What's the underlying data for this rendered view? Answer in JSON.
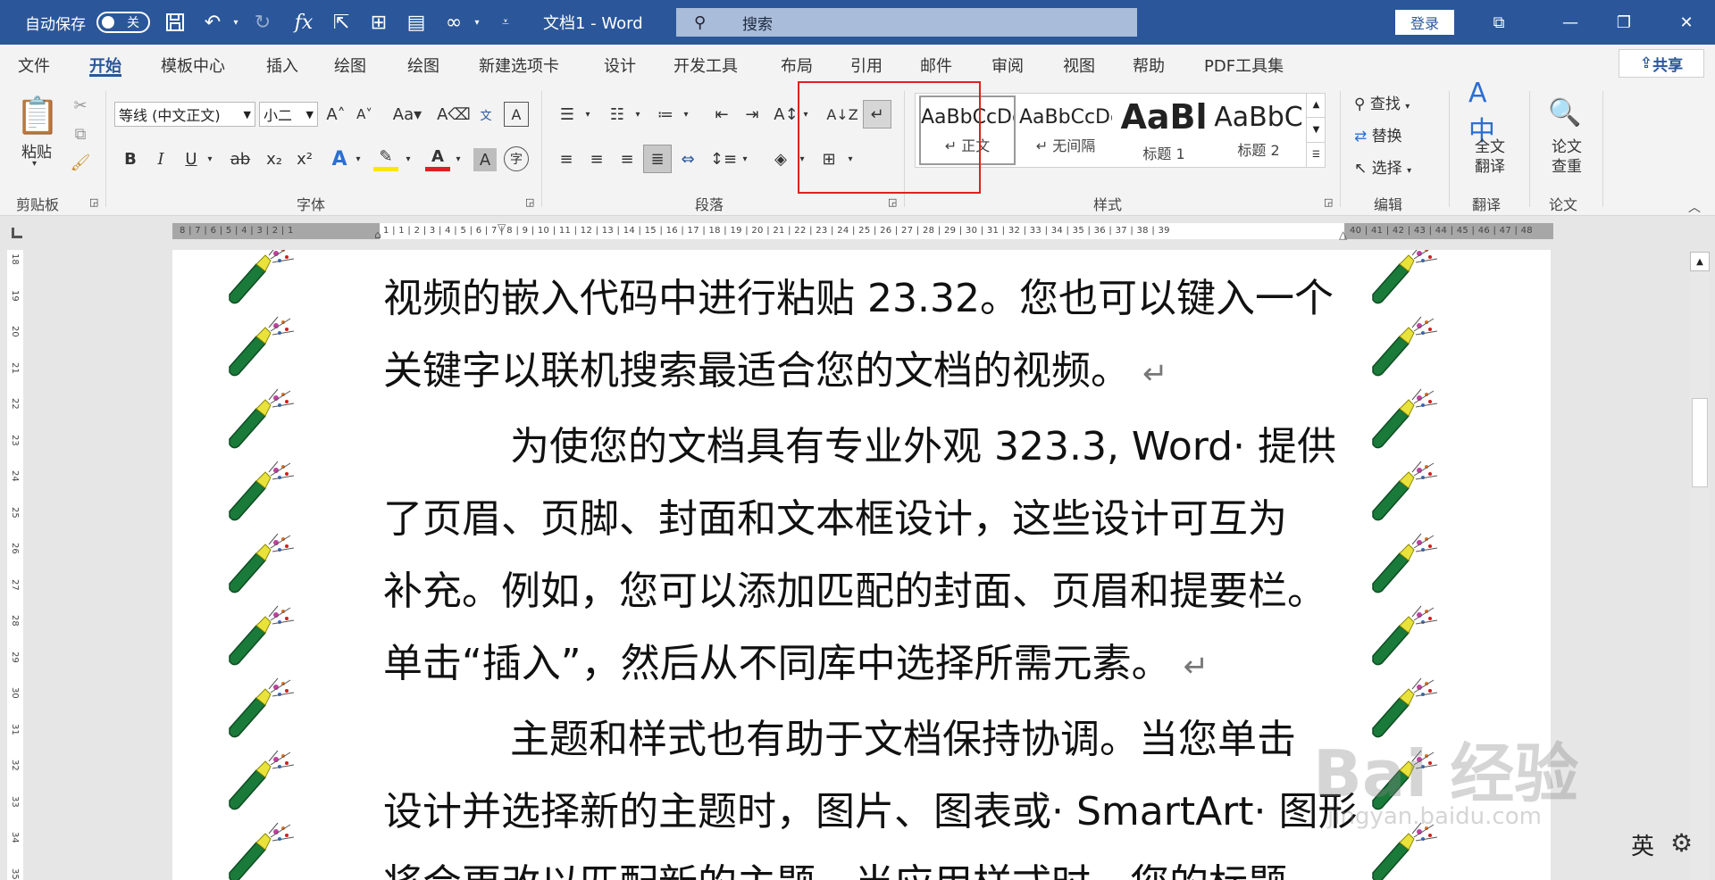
{
  "titlebar": {
    "autosave_label": "自动保存",
    "autosave_state": "关",
    "doc_title": "文档1  -  Word",
    "search_placeholder": "搜索",
    "login_label": "登录"
  },
  "tabs": [
    "文件",
    "开始",
    "模板中心",
    "插入",
    "绘图",
    "绘图",
    "新建选项卡",
    "设计",
    "开发工具",
    "布局",
    "引用",
    "邮件",
    "审阅",
    "视图",
    "帮助",
    "PDF工具集"
  ],
  "active_tab": "开始",
  "share_label": "共享",
  "ribbon": {
    "clipboard": {
      "paste_label": "粘贴",
      "group_label": "剪贴板"
    },
    "font": {
      "font_name": "等线 (中文正文)",
      "font_size": "小二",
      "group_label": "字体"
    },
    "paragraph": {
      "group_label": "段落"
    },
    "styles": {
      "group_label": "样式",
      "items": [
        {
          "sample": "AaBbCcDc",
          "name": "正文"
        },
        {
          "sample": "AaBbCcDc",
          "name": "无间隔"
        },
        {
          "sample": "AaBl",
          "name": "标题 1"
        },
        {
          "sample": "AaBbC",
          "name": "标题 2"
        }
      ]
    },
    "editing": {
      "find": "查找",
      "replace": "替换",
      "select": "选择",
      "group_label": "编辑"
    },
    "translate": {
      "label": "全文\n翻译",
      "group_label": "翻译"
    },
    "paper": {
      "label": "论文\n查重",
      "group_label": "论文"
    }
  },
  "ruler": {
    "left_ticks": "8 | 7 | 6 | 5 | 4 | 3 | 2 | 1",
    "main_ticks": "1 | 1 | 2 | 3 | 4 | 5 | 6 | 7 | 8 | 9 | 10 | 11 | 12 | 13 | 14 | 15 | 16 | 17 | 18 | 19 | 20 | 21 | 22 | 23 | 24 | 25 | 26 | 27 | 28 | 29 | 30 | 31 | 32 | 33 | 34 | 35 | 36 | 37 | 38 | 39",
    "right_ticks": "40 | 41 | 42 | 43 | 44 | 45 | 46 | 47 | 48",
    "vertical": [
      "18",
      "19",
      "20",
      "21",
      "22",
      "23",
      "24",
      "25",
      "26",
      "27",
      "28",
      "29",
      "30",
      "31",
      "32",
      "33",
      "34",
      "35"
    ]
  },
  "document": {
    "lines": [
      "视频的嵌入代码中进行粘贴 23.32。您也可以键入一个",
      "关键字以联机搜索最适合您的文档的视频。",
      "为使您的文档具有专业外观 323.3, Word· 提供",
      "了页眉、页脚、封面和文本框设计，这些设计可互为",
      "补充。例如，您可以添加匹配的封面、页眉和提要栏。",
      "单击“插入”，然后从不同库中选择所需元素。",
      "主题和样式也有助于文档保持协调。当您单击",
      "设计并选择新的主题时，图片、图表或· SmartArt· 图形",
      "将会更改以匹配新的主题。当应用样式时，您的标题"
    ],
    "para_mark": "↵"
  },
  "statusbar": {
    "ime": "英"
  },
  "watermark": {
    "brand": "Bai 经验",
    "url": "jingyan.baidu.com"
  },
  "colors": {
    "brand_blue": "#2b579a",
    "highlight_red": "#e02020"
  }
}
